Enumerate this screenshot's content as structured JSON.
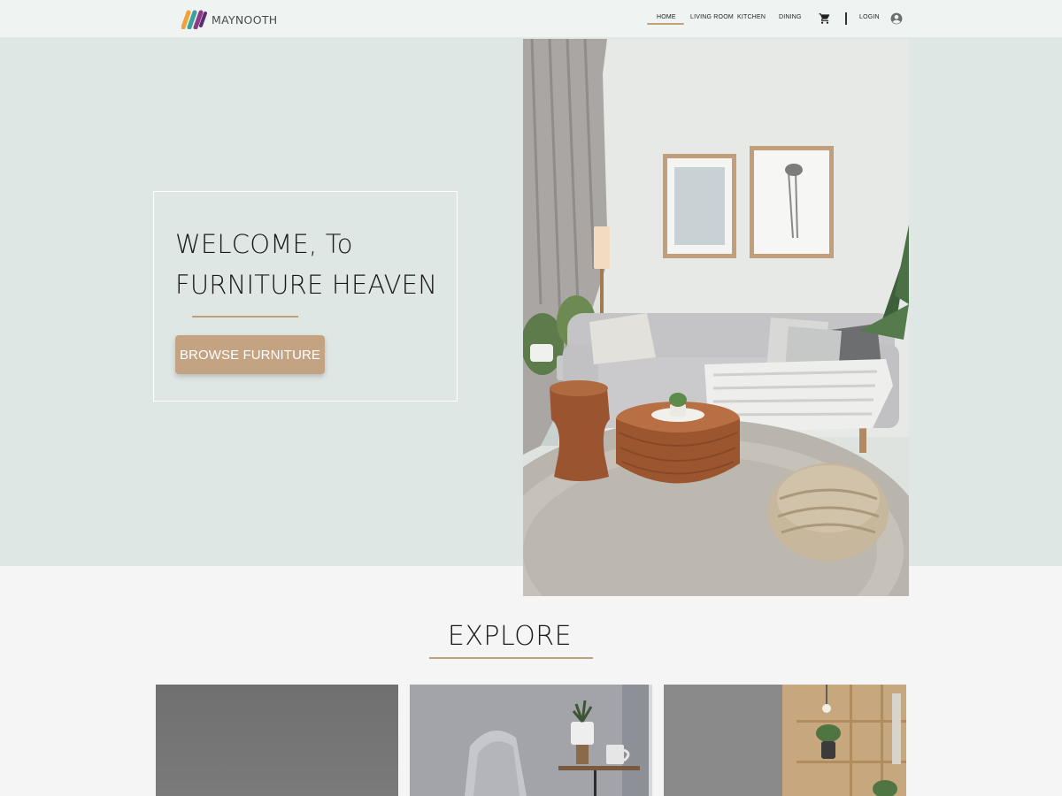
{
  "brand": {
    "name": "MAYNOOTH",
    "logo_icon": "stripes-logo-icon",
    "colors": [
      "#f0a33a",
      "#3aa29c",
      "#8c3a86"
    ]
  },
  "nav": {
    "items": [
      {
        "label": "HOME",
        "active": true
      },
      {
        "label": "LIVING ROOM",
        "active": false
      },
      {
        "label": "KITCHEN",
        "active": false
      },
      {
        "label": "DINING",
        "active": false
      }
    ],
    "cart_icon": "shopping-cart-icon",
    "login_label": "LOGIN",
    "user_icon": "account-circle-icon",
    "accent": "#c4a07a"
  },
  "hero": {
    "title_line1": "WELCOME, To",
    "title_line2": "FURNITURE HEAVEN",
    "cta_label": "BROWSE FURNITURE",
    "cta_color": "#c4a382",
    "background": "#dfe7e4",
    "image": "living-room-photo"
  },
  "explore": {
    "title": "EXPLORE",
    "cards": [
      {
        "image": "grey-wall-photo"
      },
      {
        "image": "chair-and-plant-photo"
      },
      {
        "image": "wooden-shelf-photo"
      }
    ]
  }
}
